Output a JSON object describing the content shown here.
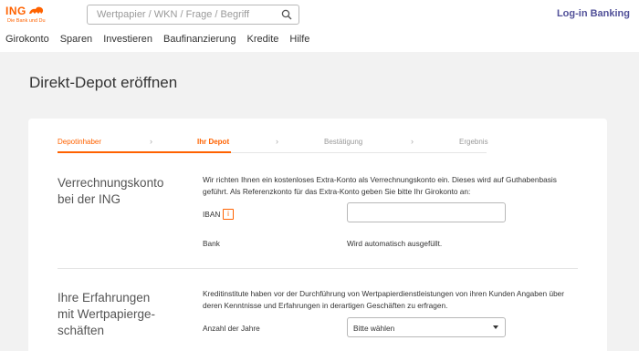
{
  "brand": {
    "name": "ING",
    "tagline": "Die Bank und Du",
    "color": "#ff6200"
  },
  "search": {
    "placeholder": "Wertpapier / WKN / Frage / Begriff",
    "icon": "search-icon"
  },
  "header": {
    "login_label": "Log-in Banking"
  },
  "nav": {
    "items": [
      "Girokonto",
      "Sparen",
      "Investieren",
      "Baufinanzierung",
      "Kredite",
      "Hilfe"
    ]
  },
  "page": {
    "title": "Direkt-Depot eröffnen"
  },
  "steps": [
    {
      "label": "Depotinhaber",
      "state": "done"
    },
    {
      "label": "Ihr Depot",
      "state": "active"
    },
    {
      "label": "Bestätigung",
      "state": "pending"
    },
    {
      "label": "Ergebnis",
      "state": "pending"
    }
  ],
  "settlement": {
    "title_line1": "Verrechnungskonto",
    "title_line2": "bei der ING",
    "text_line1": "Wir richten Ihnen ein kostenloses Extra-Konto als Verrechnungskonto ein. Dieses wird auf Guthabenbasis",
    "text_line2": "geführt. Als Referenzkonto für das Extra-Konto geben Sie bitte Ihr Girokonto an:",
    "iban_label": "IBAN",
    "iban_value": "",
    "info_icon_glyph": "i",
    "bank_label": "Bank",
    "bank_value": "Wird automatisch ausgefüllt."
  },
  "experience": {
    "title_line1": "Ihre Erfahrungen",
    "title_line2": "mit Wertpapierge-",
    "title_line3": "schäften",
    "text_line1": "Kreditinstitute haben vor der Durchführung von Wertpapierdienstleistungen von ihren Kunden Angaben über",
    "text_line2": "deren Kenntnisse und Erfahrungen in derartigen Geschäften zu erfragen.",
    "years_label": "Anzahl der Jahre",
    "years_selected": "Bitte wählen"
  },
  "colors": {
    "accent": "#ff6200",
    "login": "#525199",
    "background": "#f2f2f2"
  }
}
